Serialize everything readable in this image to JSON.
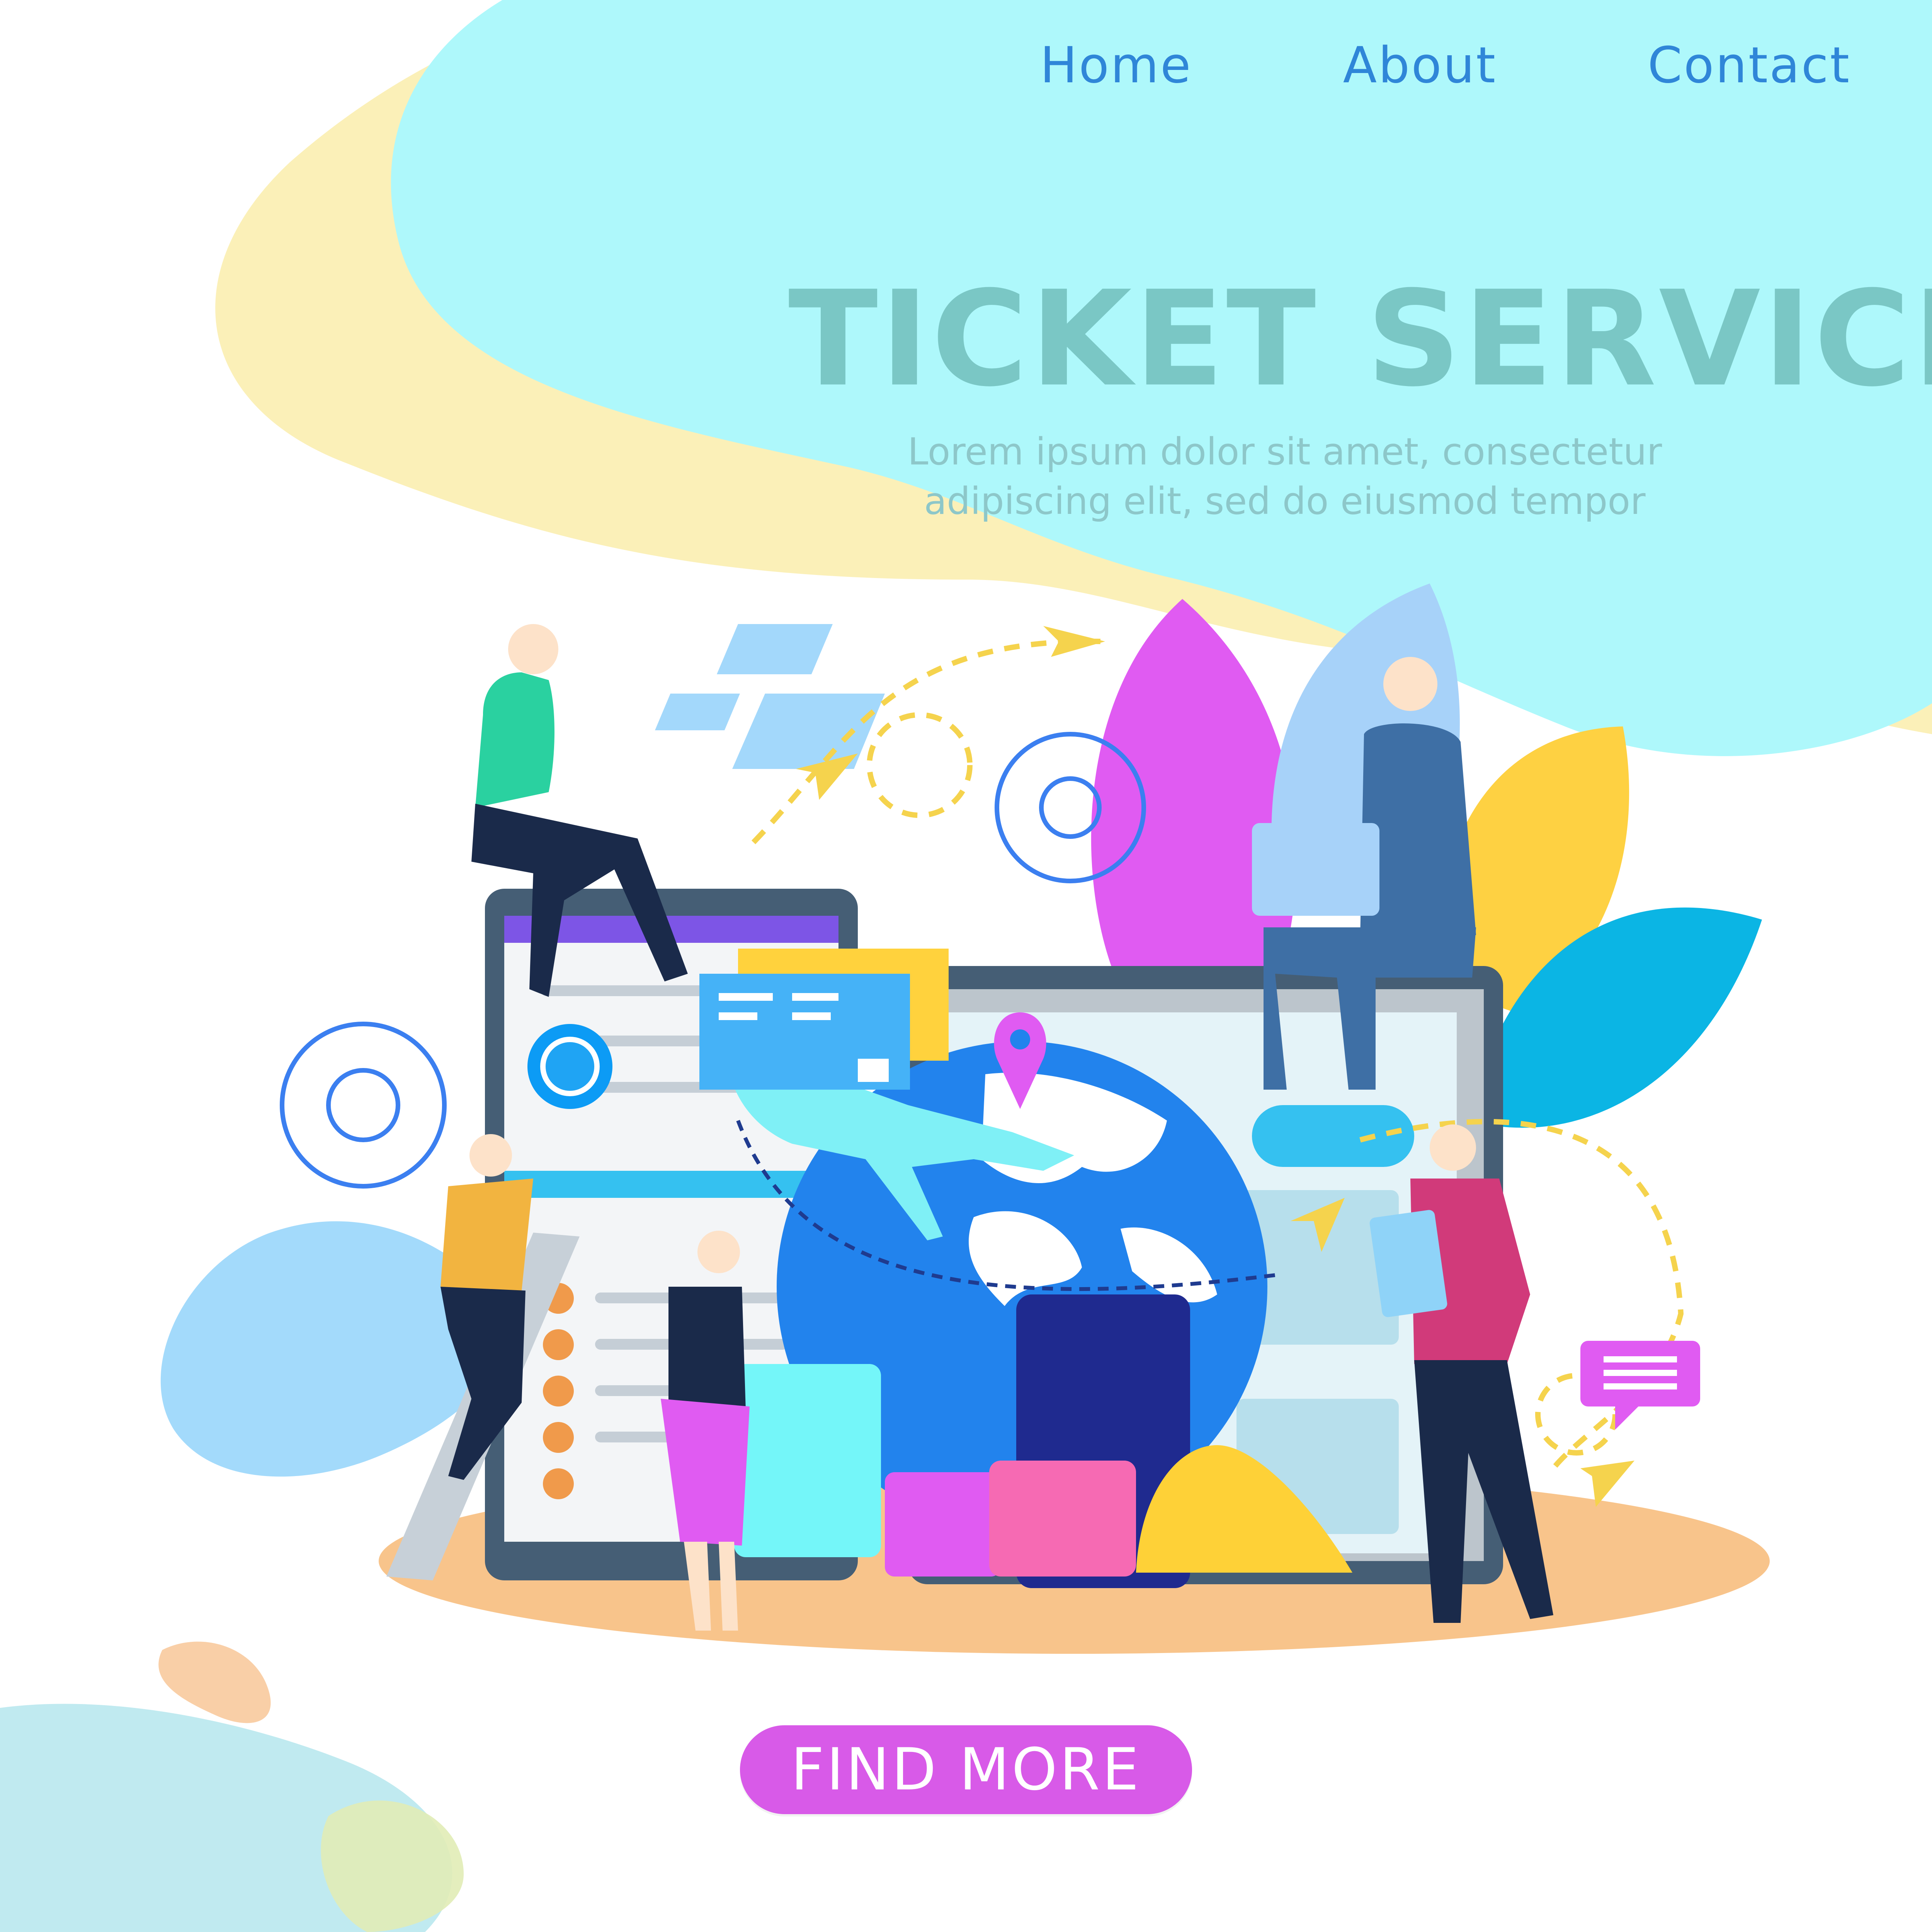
{
  "nav": {
    "items": [
      {
        "label": "Home"
      },
      {
        "label": "About"
      },
      {
        "label": "Contact"
      }
    ]
  },
  "hero": {
    "title": "TICKET SERVICE",
    "subtitle_line1": "Lorem ipsum dolor sit amet, consectetur",
    "subtitle_line2": "adipiscing elit, sed do eiusmod tempor",
    "cta_label": "FIND MORE"
  },
  "colors": {
    "accent": "#d85ae8",
    "nav_link": "#2f86d8",
    "title": "#7ac7c5",
    "sky_blob": "#aef8fb",
    "sand_blob": "#fbf0b8"
  },
  "illustration": {
    "icons": [
      "gear-icon",
      "envelope-icon",
      "paper-plane-icon",
      "location-pin-icon",
      "chat-bubble-icon",
      "globe-icon",
      "airplane-icon",
      "suitcase-icon",
      "laptop-icon",
      "tablet-icon",
      "ticket-icon"
    ]
  }
}
